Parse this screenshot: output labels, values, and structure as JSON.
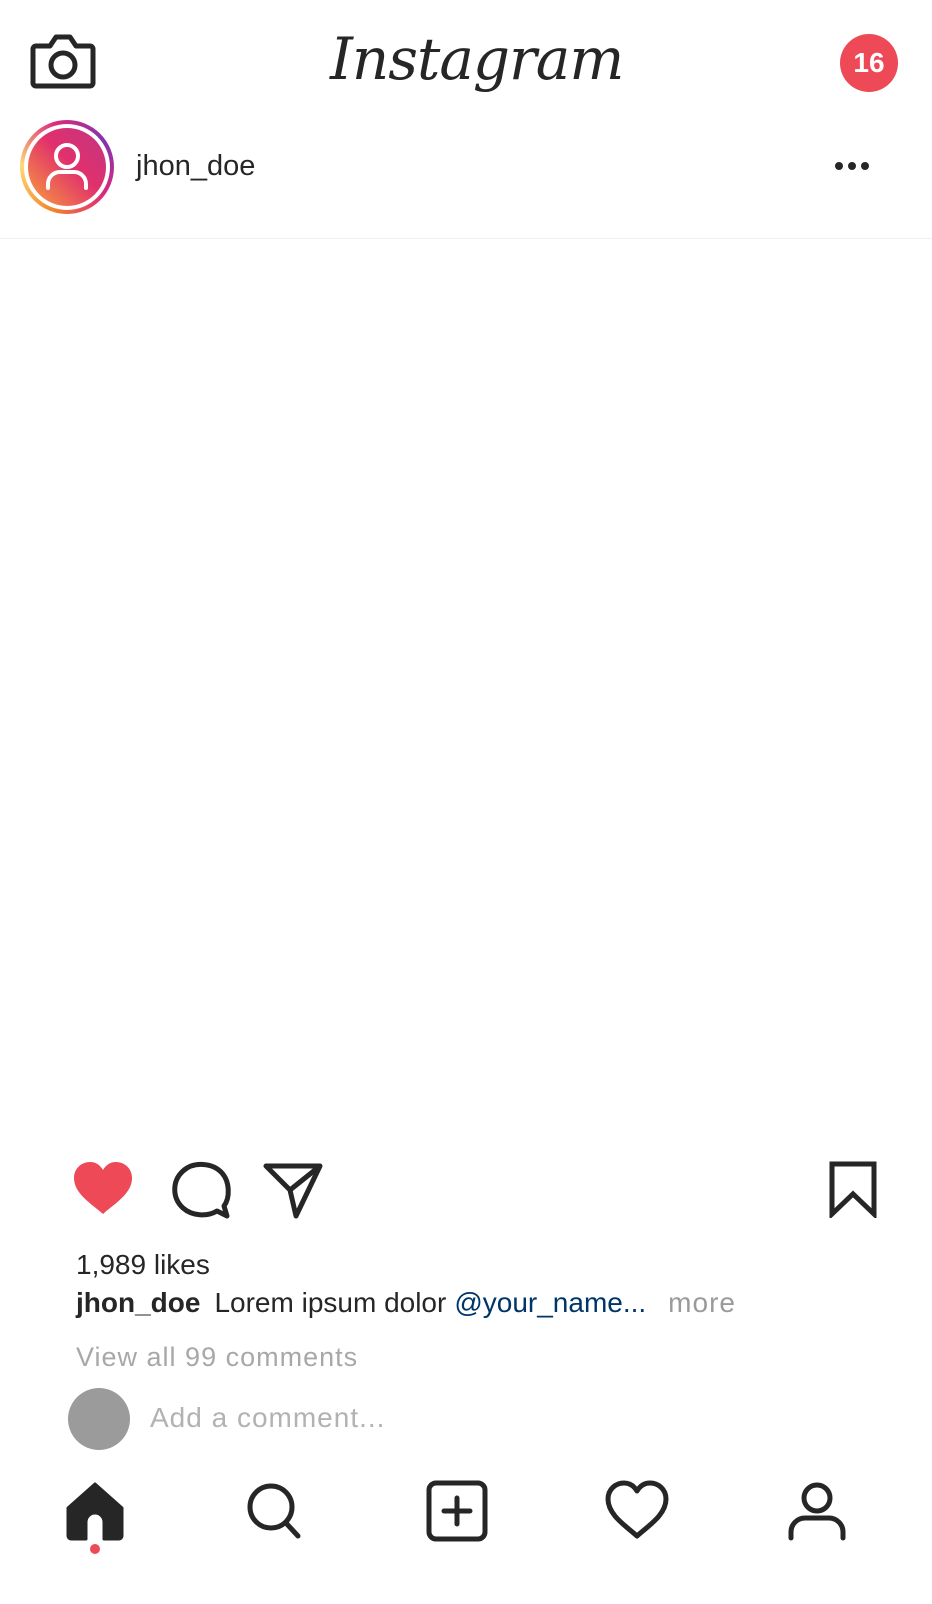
{
  "header": {
    "logo_text": "Instagram",
    "notification_count": "16",
    "icons": {
      "left": "camera-icon",
      "right": "notification-badge"
    }
  },
  "post": {
    "username": "jhon_doe",
    "menu_icon": "more-horizontal-icon",
    "likes_text": "1,989 likes",
    "caption": {
      "username": "jhon_doe",
      "text": "Lorem ipsum dolor",
      "mention": "@your_name...",
      "more_label": "more"
    },
    "view_comments_text": "View all 99 comments",
    "comment_placeholder": "Add a comment...",
    "actions": [
      "heart-filled-icon",
      "comment-icon",
      "send-icon",
      "bookmark-icon"
    ]
  },
  "nav": {
    "items": [
      "home-icon",
      "search-icon",
      "add-post-icon",
      "heart-icon",
      "profile-icon"
    ],
    "active": "home"
  },
  "colors": {
    "accent_red": "#ed4956",
    "text": "#262626",
    "mention_blue": "#003569",
    "muted": "#a8a8a8"
  }
}
